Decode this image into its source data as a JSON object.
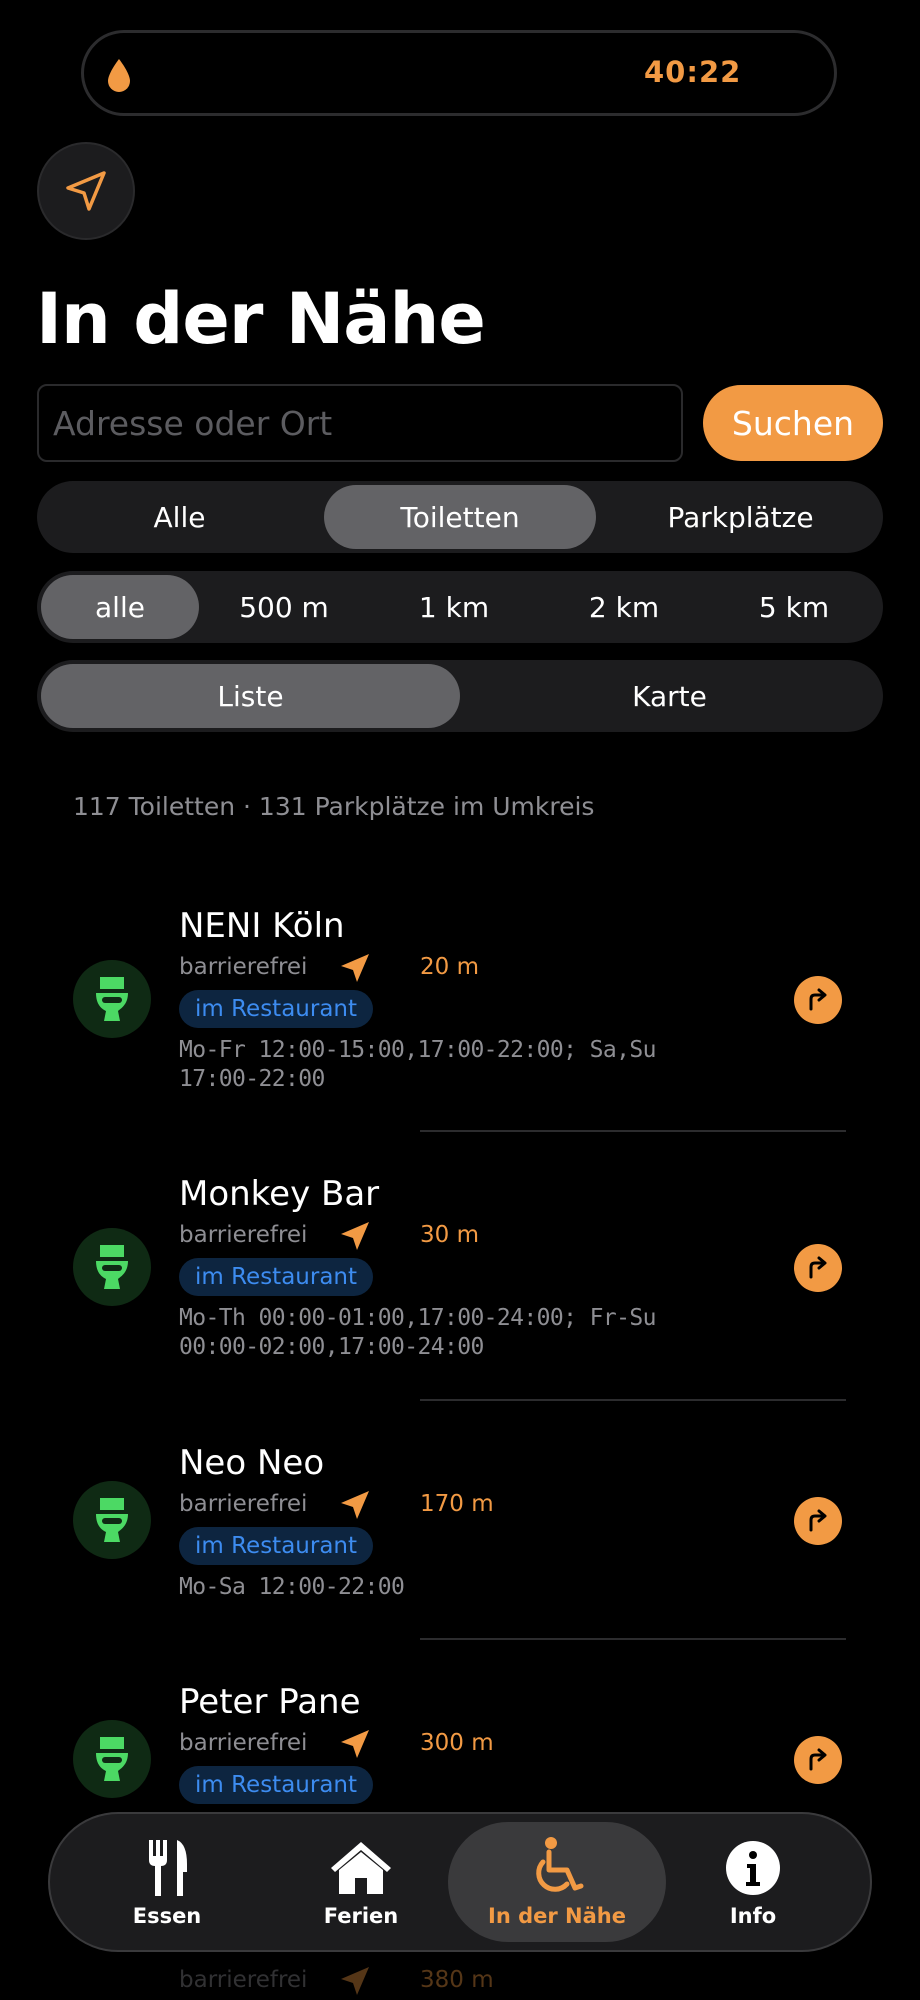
{
  "status": {
    "timer": "40:22"
  },
  "header": {
    "title": "In der Nähe"
  },
  "search": {
    "placeholder": "Adresse oder Ort",
    "button": "Suchen"
  },
  "filters": {
    "category": {
      "options": [
        "Alle",
        "Toiletten",
        "Parkplätze"
      ],
      "selected": "Toiletten"
    },
    "radius": {
      "options": [
        "alle",
        "500 m",
        "1 km",
        "2 km",
        "5 km"
      ],
      "selected": "alle"
    },
    "view": {
      "options": [
        "Liste",
        "Karte"
      ],
      "selected": "Liste"
    }
  },
  "summary": "117 Toiletten · 131 Parkplätze im Umkreis",
  "places": [
    {
      "name": "NENI Köln",
      "access": "barrierefrei",
      "distance": "20 m",
      "tag": "im Restaurant",
      "hours": "Mo-Fr 12:00-15:00,17:00-22:00; Sa,Su 17:00-22:00"
    },
    {
      "name": "Monkey Bar",
      "access": "barrierefrei",
      "distance": "30 m",
      "tag": "im Restaurant",
      "hours": "Mo-Th 00:00-01:00,17:00-24:00; Fr-Su 00:00-02:00,17:00-24:00"
    },
    {
      "name": "Neo Neo",
      "access": "barrierefrei",
      "distance": "170 m",
      "tag": "im Restaurant",
      "hours": "Mo-Sa 12:00-22:00"
    },
    {
      "name": "Peter Pane",
      "access": "barrierefrei",
      "distance": "300 m",
      "tag": "im Restaurant",
      "hours": ""
    },
    {
      "name": "",
      "access": "barrierefrei",
      "distance": "380 m",
      "tag": "",
      "hours": ""
    }
  ],
  "tabs": [
    {
      "label": "Essen",
      "icon": "fork-knife-icon"
    },
    {
      "label": "Ferien",
      "icon": "house-icon"
    },
    {
      "label": "In der Nähe",
      "icon": "wheelchair-icon",
      "active": true
    },
    {
      "label": "Info",
      "icon": "info-icon"
    }
  ],
  "colors": {
    "accent": "#f29a44",
    "tag_text": "#3d8cf0",
    "toilet_green": "#4cd964"
  }
}
